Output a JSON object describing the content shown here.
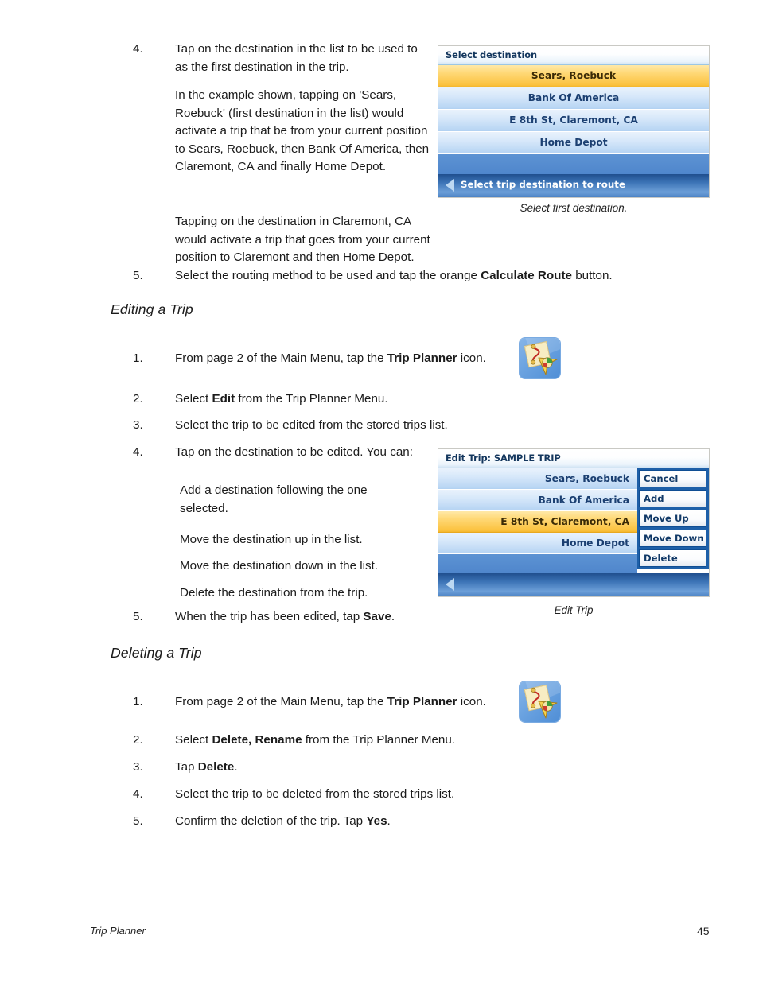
{
  "doc": {
    "footer_section": "Trip Planner",
    "page_number": "45"
  },
  "steps_top": [
    {
      "num": "4.",
      "paras": [
        "Tap on the destination in the list to be used to as the first destination in the trip.",
        "In the example shown, tapping on 'Sears, Roebuck' (first destination in the list) would activate a trip that be from your current position to Sears, Roebuck, then Bank Of America, then Claremont, CA and finally Home Depot.",
        "Tapping on the destination in Claremont, CA would activate a trip that goes from your current position to Claremont and then Home Depot."
      ]
    }
  ],
  "step5_top": {
    "num": "5.",
    "text_before": "Select the routing method to be used and tap the orange ",
    "bold": "Calculate Route",
    "text_after": " button."
  },
  "sections": {
    "editing": "Editing a Trip",
    "deleting": "Deleting a Trip"
  },
  "editing_steps": {
    "s1": {
      "num": "1.",
      "before": "From page 2 of the Main Menu, tap the ",
      "bold": "Trip Planner",
      "after": " icon."
    },
    "s2": {
      "num": "2.",
      "before": "Select ",
      "bold": "Edit",
      "after": " from the Trip Planner Menu."
    },
    "s3": {
      "num": "3.",
      "before": "Select the trip to be edited from the stored trips list.",
      "bold": "",
      "after": ""
    },
    "s4": {
      "num": "4.",
      "before": "Tap on the destination to be edited.  You can:",
      "bold": "",
      "after": ""
    },
    "s4_bullets": [
      "Add a destination following the one selected.",
      "Move the destination up in the list.",
      "Move the destination down in the list.",
      "Delete the destination from the trip."
    ],
    "s5": {
      "num": "5.",
      "before": "When the trip has been edited, tap ",
      "bold": "Save",
      "after": "."
    }
  },
  "deleting_steps": {
    "s1": {
      "num": "1.",
      "before": "From page 2 of the Main Menu, tap the ",
      "bold": "Trip Planner",
      "after": " icon."
    },
    "s2": {
      "num": "2.",
      "before": "Select ",
      "bold": "Delete, Rename",
      "after": " from the Trip Planner Menu."
    },
    "s3": {
      "num": "3.",
      "before": "Tap ",
      "bold": "Delete",
      "after": "."
    },
    "s4": {
      "num": "4.",
      "before": "Select the trip to be deleted from the stored trips list.",
      "bold": "",
      "after": ""
    },
    "s5": {
      "num": "5.",
      "before": "Confirm the deletion of the trip.  Tap ",
      "bold": "Yes",
      "after": "."
    }
  },
  "figure_select": {
    "title": "Select destination",
    "rows": [
      {
        "label": "Sears, Roebuck",
        "selected": true
      },
      {
        "label": "Bank Of America",
        "selected": false
      },
      {
        "label": "E 8th St, Claremont, CA",
        "selected": false
      },
      {
        "label": "Home Depot",
        "selected": false
      }
    ],
    "nav_label": "Select trip destination to route",
    "caption": "Select first destination."
  },
  "figure_edit": {
    "title": "Edit Trip: SAMPLE TRIP",
    "rows": [
      {
        "label": "Sears, Roebuck",
        "selected": false
      },
      {
        "label": "Bank Of America",
        "selected": false
      },
      {
        "label": "E 8th St, Claremont, CA",
        "selected": true
      },
      {
        "label": "Home Depot",
        "selected": false
      }
    ],
    "buttons": [
      "Cancel",
      "Add",
      "Move Up",
      "Move Down",
      "Delete"
    ],
    "nav_label": "",
    "caption": "Edit Trip"
  },
  "icons": {
    "trip_planner": "trip-planner-icon"
  },
  "colors": {
    "accent_orange": "#fbc23f",
    "accent_blue": "#4f86cc",
    "title_text": "#14375e",
    "row_text": "#1b3f71"
  }
}
